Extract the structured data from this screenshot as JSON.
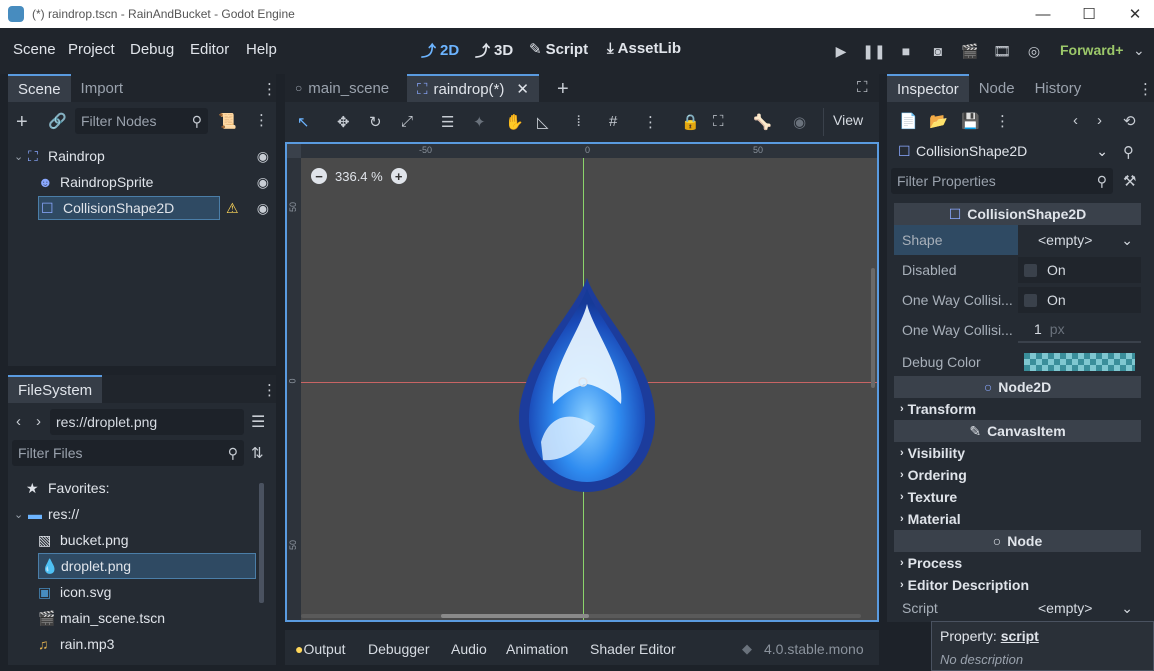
{
  "window": {
    "title": "(*) raindrop.tscn - RainAndBucket - Godot Engine"
  },
  "menu": [
    "Scene",
    "Project",
    "Debug",
    "Editor",
    "Help"
  ],
  "workspaces": [
    {
      "label": "2D",
      "icon": "2d-icon"
    },
    {
      "label": "3D",
      "icon": "3d-icon"
    },
    {
      "label": "Script",
      "icon": "script-icon"
    },
    {
      "label": "AssetLib",
      "icon": "assetlib-icon"
    }
  ],
  "renderer": "Forward+",
  "scene_dock": {
    "tabs": [
      "Scene",
      "Import"
    ],
    "filter_placeholder": "Filter Nodes",
    "nodes": [
      {
        "name": "Raindrop",
        "icon": "node2d-icon"
      },
      {
        "name": "RaindropSprite",
        "icon": "sprite-icon"
      },
      {
        "name": "CollisionShape2D",
        "icon": "collision-icon"
      }
    ]
  },
  "filesystem": {
    "tab": "FileSystem",
    "path": "res://droplet.png",
    "filter_placeholder": "Filter Files",
    "favorites": "Favorites:",
    "root": "res://",
    "files": [
      "bucket.png",
      "droplet.png",
      "icon.svg",
      "main_scene.tscn",
      "rain.mp3"
    ]
  },
  "editor_tabs": [
    "main_scene",
    "raindrop(*)"
  ],
  "viewport": {
    "zoom": "336.4 %",
    "view_menu": "View",
    "ruler_h": [
      "-50",
      "0",
      "50"
    ],
    "ruler_v": [
      "50",
      "0",
      "50"
    ]
  },
  "inspector": {
    "tabs": [
      "Inspector",
      "Node",
      "History"
    ],
    "node_select": "CollisionShape2D",
    "filter_placeholder": "Filter Properties",
    "class_header": "CollisionShape2D",
    "properties": {
      "shape_label": "Shape",
      "shape_value": "<empty>",
      "disabled_label": "Disabled",
      "disabled_value": "On",
      "oneway_label": "One Way Collisi...",
      "oneway_value": "On",
      "onewaymargin_label": "One Way Collisi...",
      "onewaymargin_value": "1",
      "onewaymargin_unit": "px",
      "debug_label": "Debug Color"
    },
    "node2d_header": "Node2D",
    "transform": "Transform",
    "canvas_header": "CanvasItem",
    "canvas_groups": [
      "Visibility",
      "Ordering",
      "Texture",
      "Material"
    ],
    "node_header": "Node",
    "node_groups": [
      "Process",
      "Editor Description"
    ],
    "script_label": "Script",
    "script_value": "<empty>",
    "tooltip_title": "Property:",
    "tooltip_prop": "script",
    "tooltip_desc": "No description"
  },
  "bottom": {
    "tabs": [
      "Output",
      "Debugger",
      "Audio",
      "Animation",
      "Shader Editor"
    ],
    "version": "4.0.stable.mono"
  }
}
